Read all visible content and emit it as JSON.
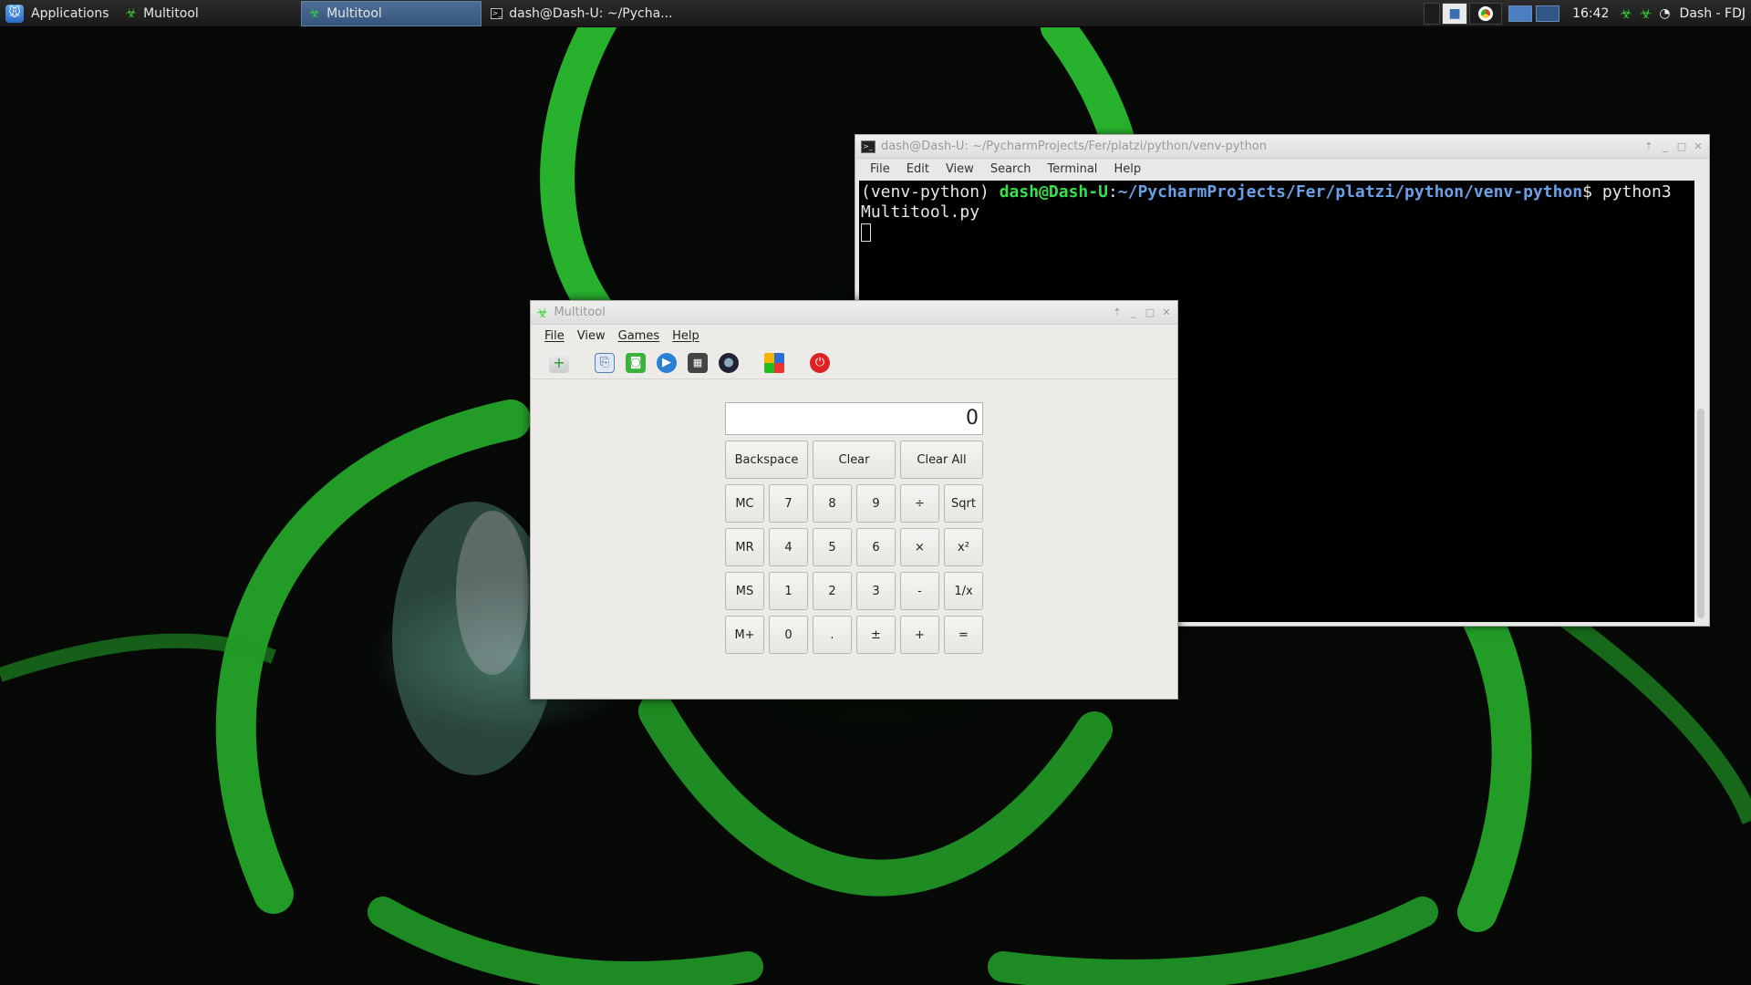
{
  "panel": {
    "applications_label": "Applications",
    "tasks": [
      {
        "label": "Multitool",
        "icon": "biohazard-icon",
        "active": false
      },
      {
        "label": "Multitool",
        "icon": "biohazard-icon",
        "active": true
      },
      {
        "label": "dash@Dash-U: ~/Pycha...",
        "icon": "terminal-icon",
        "active": false
      }
    ],
    "clock": "16:42",
    "user": "Dash - FDJ"
  },
  "terminal": {
    "title": "dash@Dash-U: ~/PycharmProjects/Fer/platzi/python/venv-python",
    "menu": [
      "File",
      "Edit",
      "View",
      "Search",
      "Terminal",
      "Help"
    ],
    "prompt_env": "(venv-python) ",
    "prompt_user_host": "dash@Dash-U",
    "prompt_colon": ":",
    "prompt_path": "~/PycharmProjects/Fer/platzi/python/venv-python",
    "prompt_symbol": "$ ",
    "command_part1": "python3",
    "command_part2": "Multitool.py"
  },
  "multitool": {
    "title": "Multitool",
    "menu": [
      "File",
      "View",
      "Games",
      "Help"
    ],
    "toolbar": [
      "add-file-icon",
      "clipboard-icon",
      "camera-icon",
      "play-icon",
      "calculator-icon",
      "webcam-icon",
      "grid-icon",
      "power-icon"
    ],
    "display_value": "0",
    "buttons": {
      "backspace": "Backspace",
      "clear": "Clear",
      "clear_all": "Clear All",
      "rows": [
        [
          "MC",
          "7",
          "8",
          "9",
          "÷",
          "Sqrt"
        ],
        [
          "MR",
          "4",
          "5",
          "6",
          "×",
          "x²"
        ],
        [
          "MS",
          "1",
          "2",
          "3",
          "-",
          "1/x"
        ],
        [
          "M+",
          "0",
          ".",
          "±",
          "+",
          "="
        ]
      ]
    }
  },
  "colors": {
    "accent": "#38d43a",
    "panel": "#1f1f1f",
    "terminal_bg": "#000000",
    "prompt_green": "#38e04a",
    "prompt_blue": "#6aa0e8",
    "active_task": "#36557d"
  }
}
